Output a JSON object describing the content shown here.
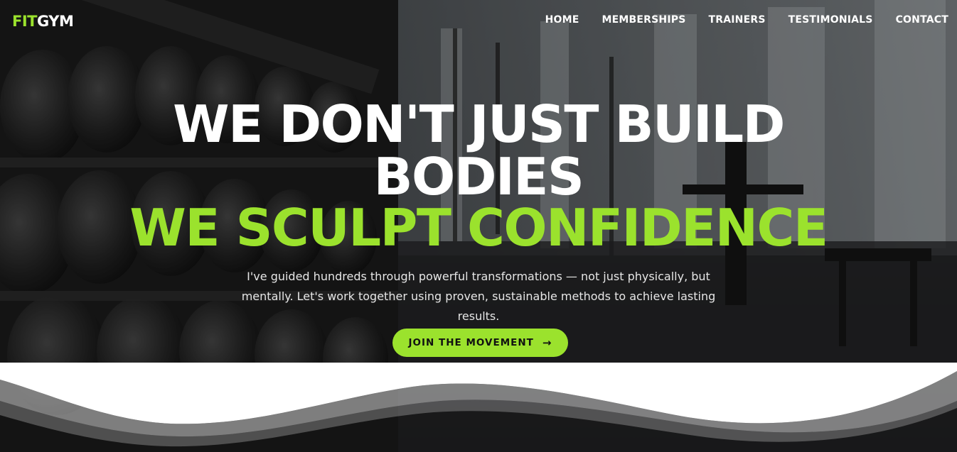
{
  "brand": {
    "logo_part1": "FIT",
    "logo_part2": "GYM"
  },
  "nav": {
    "items": [
      {
        "label": "HOME"
      },
      {
        "label": "MEMBERSHIPS"
      },
      {
        "label": "TRAINERS"
      },
      {
        "label": "TESTIMONIALS"
      },
      {
        "label": "CONTACT"
      }
    ]
  },
  "hero": {
    "headline_line1": "WE DON'T JUST BUILD",
    "headline_line2": "BODIES",
    "headline_line3": "WE SCULPT CONFIDENCE",
    "subtext_line1": "I've guided hundreds through powerful transformations — not just physically, but",
    "subtext_line2": "mentally. Let's work together using proven, sustainable methods to achieve lasting results.",
    "cta_label": "JOIN THE MOVEMENT",
    "cta_icon": "arrow-right-icon"
  },
  "colors": {
    "accent": "#9be22d",
    "text": "#ffffff"
  }
}
